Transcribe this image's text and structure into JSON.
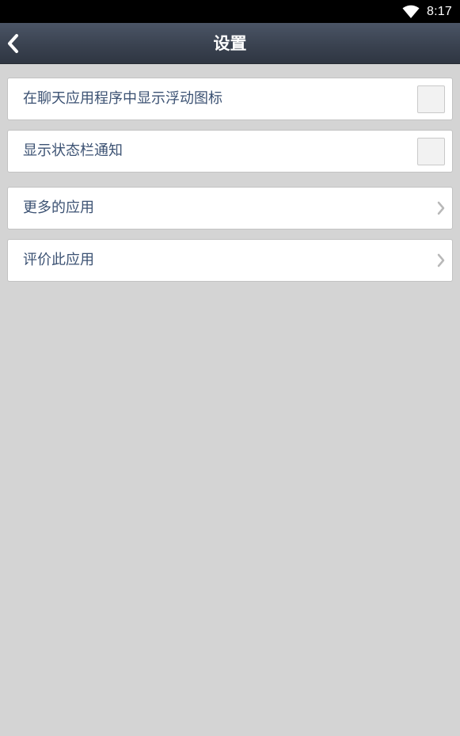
{
  "status_bar": {
    "time": "8:17",
    "icons": [
      "wifi-icon"
    ]
  },
  "header": {
    "title": "设置",
    "back_icon": "chevron-left-icon"
  },
  "settings": {
    "items": [
      {
        "label": "在聊天应用程序中显示浮动图标",
        "control": "checkbox",
        "checked": false
      },
      {
        "label": "显示状态栏通知",
        "control": "checkbox",
        "checked": false
      },
      {
        "label": "更多的应用",
        "control": "chevron-right-icon"
      },
      {
        "label": "评价此应用",
        "control": "chevron-right-icon"
      }
    ]
  },
  "colors": {
    "background": "#d4d4d4",
    "header_top": "#4b5566",
    "header_bottom": "#2f3642",
    "label_text": "#3c5273",
    "card": "#ffffff"
  }
}
